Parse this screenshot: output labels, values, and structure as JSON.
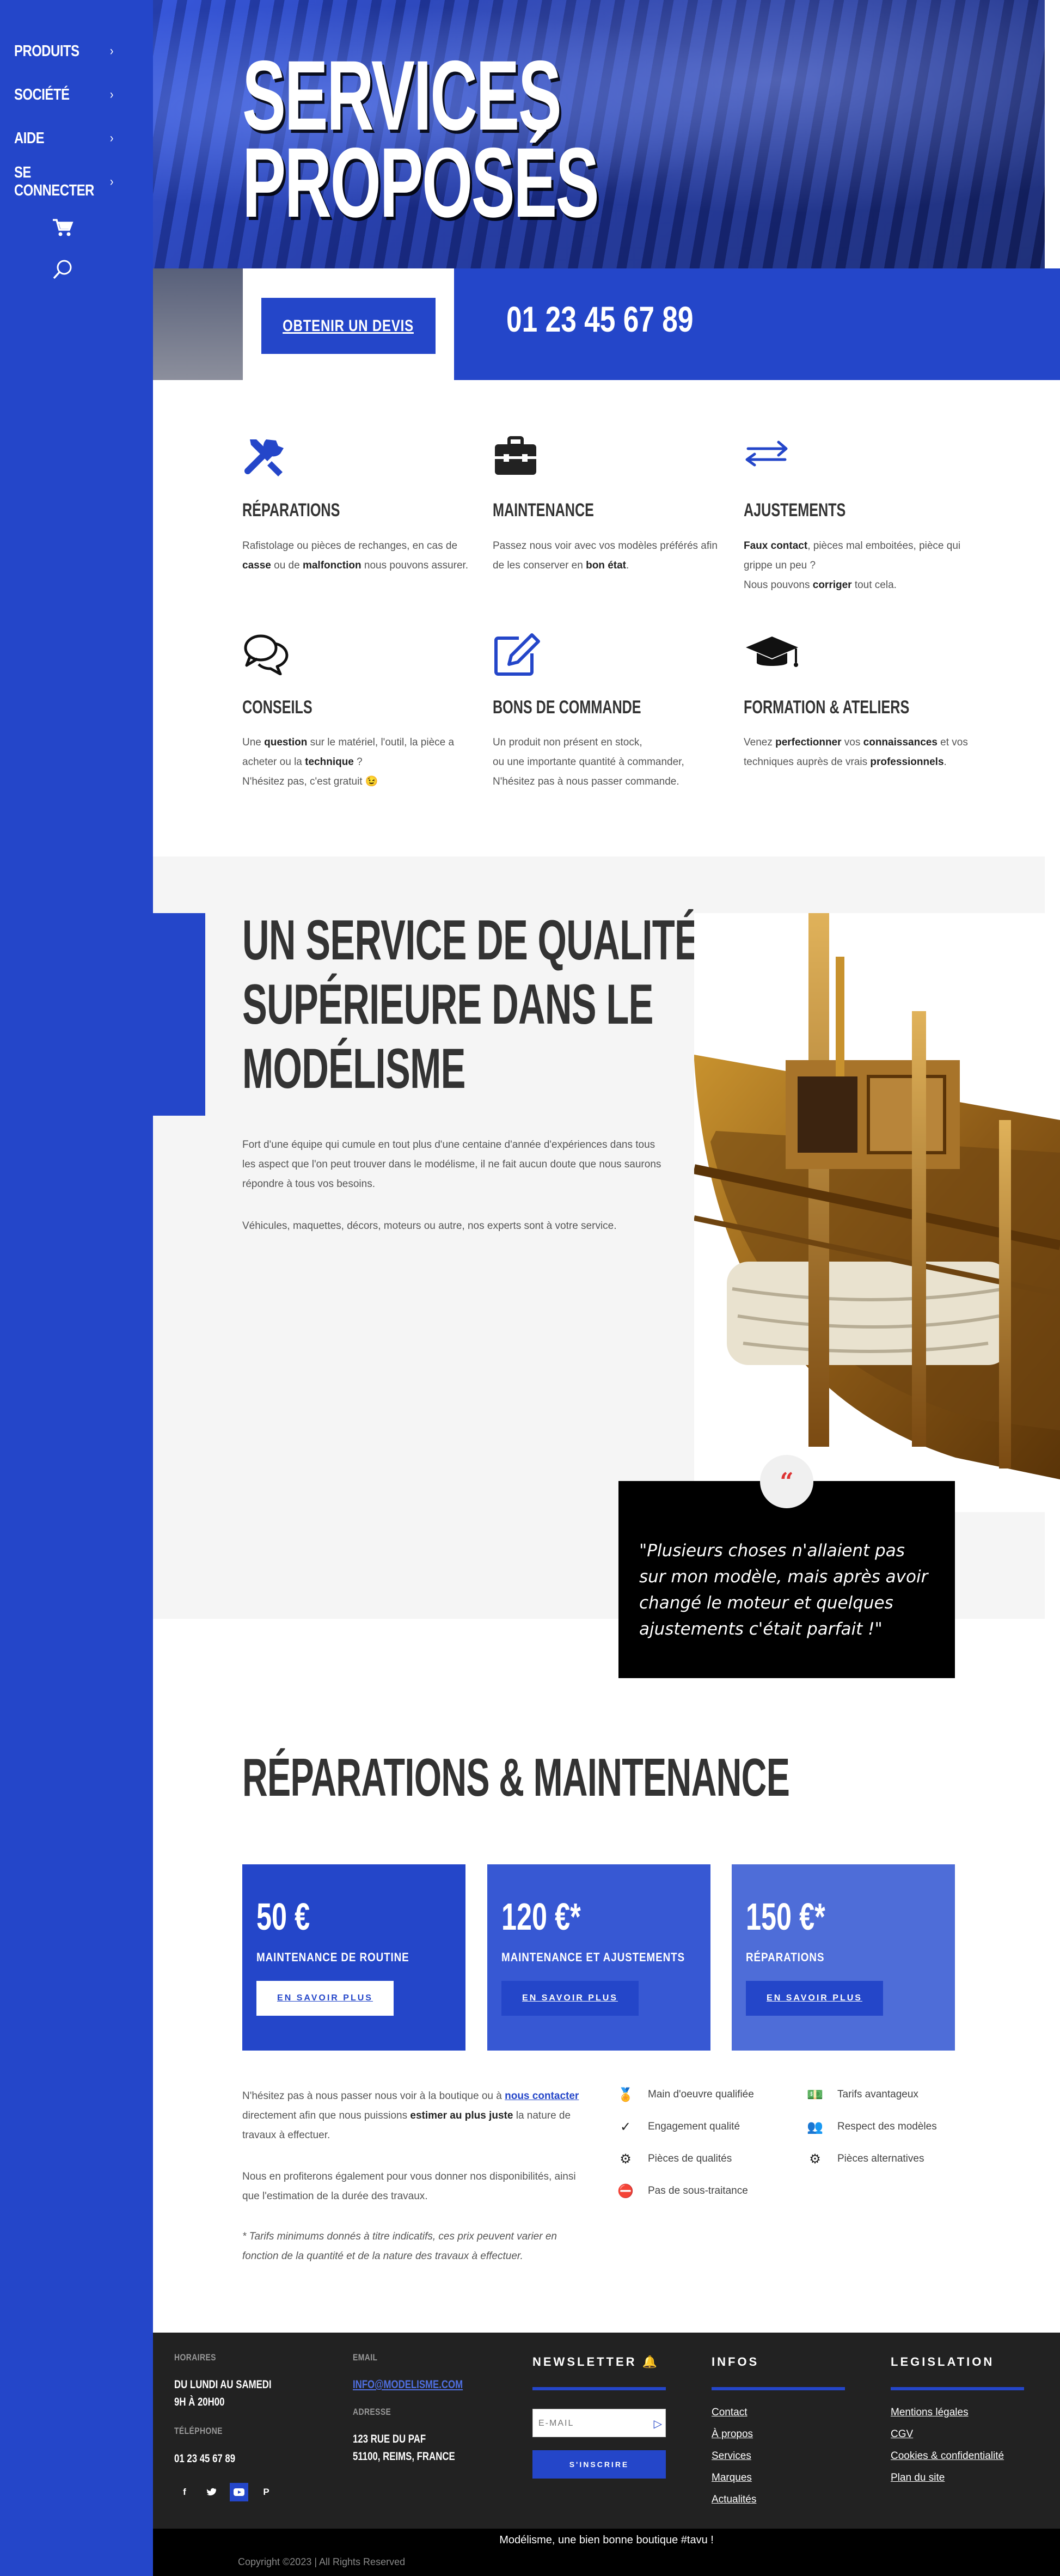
{
  "sidebar": {
    "items": [
      {
        "label": "PRODUITS"
      },
      {
        "label": "SOCIÉTÉ"
      },
      {
        "label": "AIDE"
      },
      {
        "label": "SE CONNECTER"
      }
    ],
    "cart_icon": "cart-icon",
    "search_icon": "search-icon"
  },
  "hero": {
    "title_line1": "SERVICES",
    "title_line2": "PROPOSÉS",
    "cta_label": "OBTENIR UN DEVIS",
    "phone": "01 23 45 67 89"
  },
  "services": [
    {
      "icon": "tools-icon",
      "title": "RÉPARATIONS",
      "desc_html": "Rafistolage ou pièces de rechanges, en cas de <b>casse</b> ou de <b>malfonction</b> nous pouvons assurer."
    },
    {
      "icon": "toolbox-icon",
      "title": "MAINTENANCE",
      "desc_html": "Passez nous voir avec vos modèles préférés afin de les conserver en <b>bon état</b>."
    },
    {
      "icon": "arrows-icon",
      "title": "AJUSTEMENTS",
      "desc_html": "<b>Faux contact</b>, pièces mal emboitées, pièce qui grippe un peu ?<br>Nous pouvons <b>corriger</b> tout cela."
    },
    {
      "icon": "chat-icon",
      "title": "CONSEILS",
      "desc_html": "Une <b>question</b> sur le matériel, l'outil, la pièce a acheter ou la <b>technique</b> ?<br>N'hésitez pas, c'est gratuit 😉"
    },
    {
      "icon": "edit-icon",
      "title": "BONS DE COMMANDE",
      "desc_html": "Un produit non présent en stock,<br>ou une importante quantité à commander,<br>N'hésitez pas à nous passer commande."
    },
    {
      "icon": "graduation-cap-icon",
      "title": "FORMATION & ATELIERS",
      "desc_html": "Venez <b>perfectionner</b> vos <b>connaissances</b> et vos techniques auprès de vrais <b>professionnels</b>."
    }
  ],
  "quality": {
    "title_line1": "UN SERVICE DE QUALITÉ",
    "title_line2": "SUPÉRIEURE DANS LE",
    "title_line3": "MODÉLISME",
    "paragraph1": "Fort d'une équipe qui cumule en tout plus d'une centaine d'année d'expériences dans tous les aspect que l'on peut trouver dans le modélisme, il ne fait aucun doute que nous saurons répondre à tous vos besoins.",
    "paragraph2": "Véhicules, maquettes, décors, moteurs ou autre, nos experts sont à votre service.",
    "quote_mark": "“",
    "quote": "\"Plusieurs choses n'allaient pas sur mon modèle, mais après avoir changé le moteur et quelques ajustements c'était parfait !\""
  },
  "pricing": {
    "title": "RÉPARATIONS & MAINTENANCE",
    "cards": [
      {
        "price": "50 €",
        "name": "MAINTENANCE DE ROUTINE",
        "button": "EN SAVOIR PLUS",
        "color": "#2446c9"
      },
      {
        "price": "120 €*",
        "name": "MAINTENANCE ET AJUSTEMENTS",
        "button": "EN SAVOIR PLUS",
        "color": "#3758d3"
      },
      {
        "price": "150 €*",
        "name": "RÉPARATIONS",
        "button": "EN SAVOIR PLUS",
        "color": "#4e6dd8"
      }
    ]
  },
  "info": {
    "p1_before": "N'hésitez pas à nous passer nous voir à la boutique ou à ",
    "p1_link": "nous contacter",
    "p1_middle": " directement afin que nous puissions ",
    "p1_bold": "estimer au plus juste",
    "p1_after": " la nature de travaux à effectuer.",
    "p2": "Nous en profiterons également pour vous donner nos disponibilités, ainsi que l'estimation de la durée des travaux.",
    "note": "* Tarifs minimums donnés à titre indicatifs, ces prix peuvent varier en fonction de la quantité et de la nature des travaux à effectuer.",
    "features_left": [
      {
        "icon": "medal-icon",
        "label": "Main d'oeuvre qualifiée"
      },
      {
        "icon": "check-icon",
        "label": "Engagement qualité"
      },
      {
        "icon": "gear-icon",
        "label": "Pièces de qualités"
      },
      {
        "icon": "no-subcontract-icon",
        "label": "Pas de sous-traitance"
      }
    ],
    "features_right": [
      {
        "icon": "money-icon",
        "label": "Tarifs avantageux"
      },
      {
        "icon": "people-icon",
        "label": "Respect des modèles"
      },
      {
        "icon": "gears-icon",
        "label": "Pièces alternatives"
      }
    ]
  },
  "footer": {
    "hours_label": "HORAIRES",
    "hours_line1": "DU LUNDI AU SAMEDI",
    "hours_line2": "9H À 20H00",
    "phone_label": "TÉLÉPHONE",
    "phone": "01 23 45 67 89",
    "email_label": "EMAIL",
    "email": "INFO@MODELISME.COM",
    "address_label": "ADRESSE",
    "address_line1": "123 RUE DU PAF",
    "address_line2": "51100, REIMS, FRANCE",
    "newsletter_title": "NEWSLETTER 🔔",
    "newsletter_placeholder": "E-MAIL",
    "newsletter_button": "S'INSCRIRE",
    "infos_title": "INFOS",
    "infos_links": [
      "Contact",
      "À propos",
      "Services",
      "Marques",
      "Actualités"
    ],
    "legal_title": "LEGISLATION",
    "legal_links": [
      "Mentions légales",
      "CGV",
      "Cookies & confidentialité",
      "Plan du site"
    ],
    "social": [
      "facebook-icon",
      "twitter-icon",
      "youtube-icon",
      "pinterest-icon"
    ],
    "tagline": "Modélisme, une bien bonne boutique #tavu !",
    "copyright": "Copyright ©2023 | All Rights Reserved"
  },
  "colors": {
    "brand": "#2446c9",
    "dark": "#222222",
    "light_bg": "#f5f5f5"
  }
}
